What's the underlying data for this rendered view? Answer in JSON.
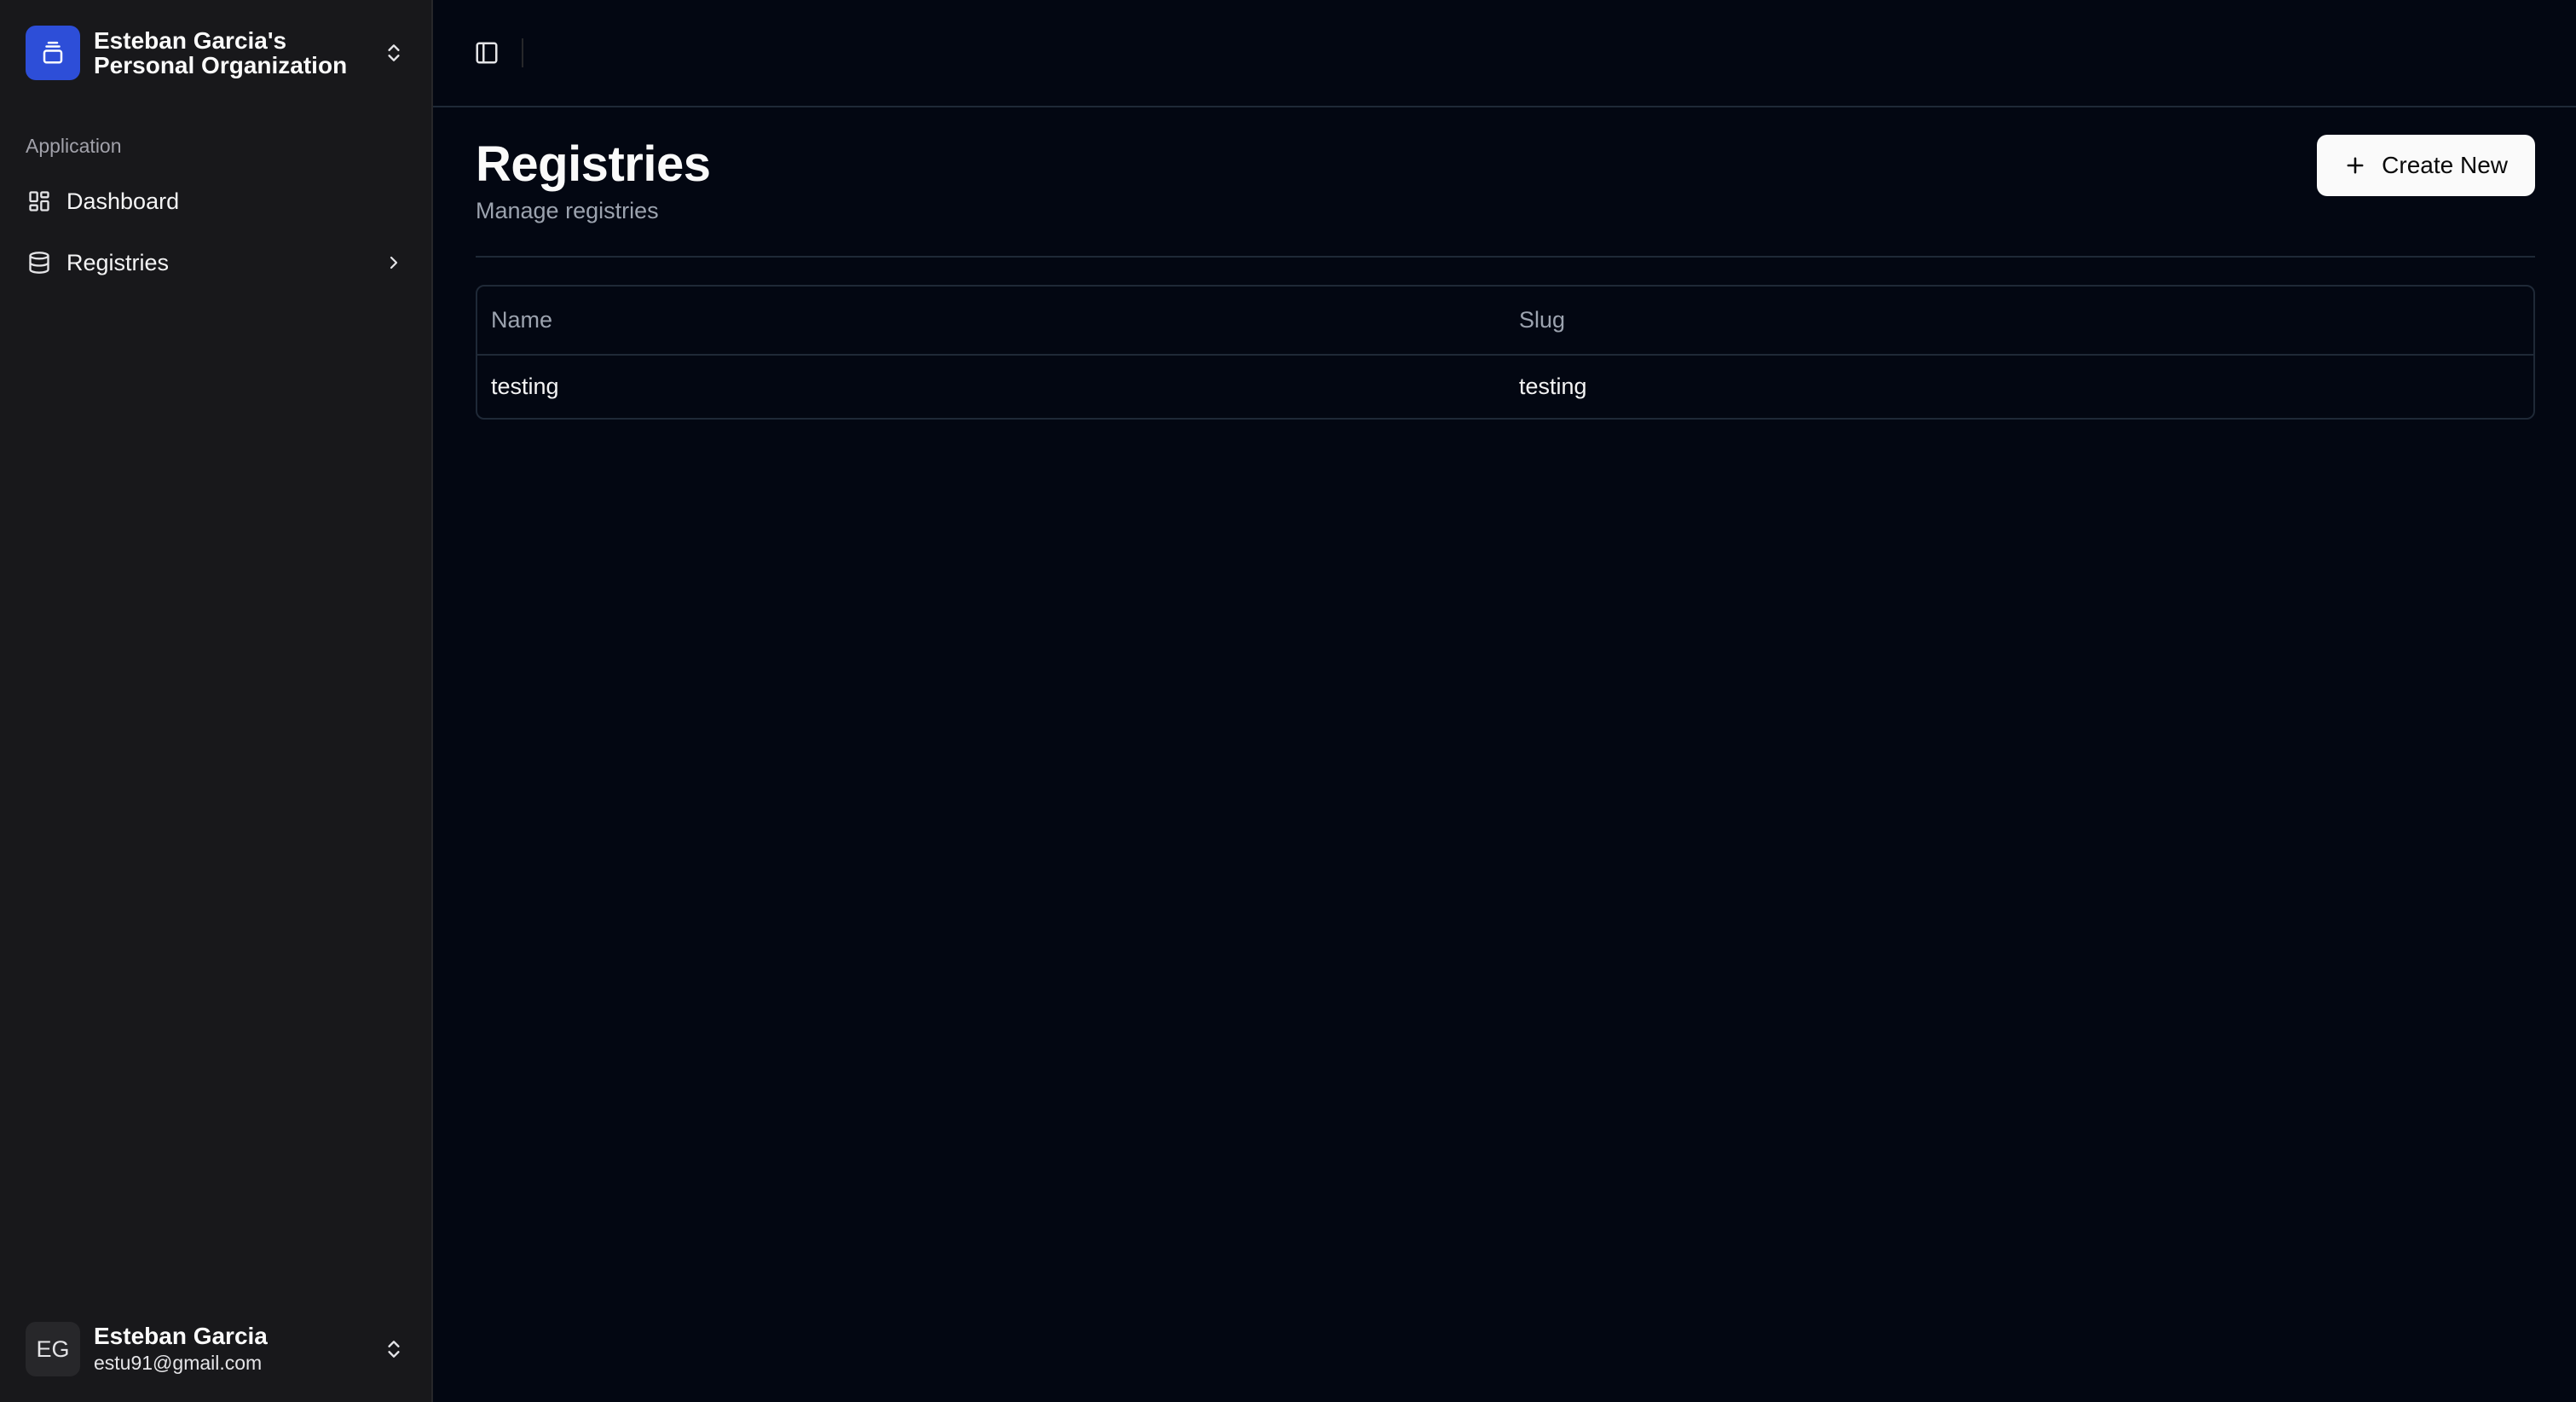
{
  "sidebar": {
    "org": {
      "name_line1": "Esteban Garcia's",
      "name_line2": "Personal Organization",
      "logo_icon": "box-stack-icon",
      "accent": "#2d4ed8"
    },
    "group_label": "Application",
    "items": [
      {
        "label": "Dashboard",
        "icon": "layout-grid-icon"
      },
      {
        "label": "Registries",
        "icon": "database-icon",
        "has_submenu": true
      }
    ],
    "user": {
      "initials": "EG",
      "name": "Esteban Garcia",
      "email": "estu91@gmail.com"
    }
  },
  "page": {
    "title": "Registries",
    "subtitle": "Manage registries",
    "create_label": "Create New"
  },
  "table": {
    "columns": [
      "Name",
      "Slug"
    ],
    "rows": [
      {
        "name": "testing",
        "slug": "testing"
      }
    ]
  }
}
